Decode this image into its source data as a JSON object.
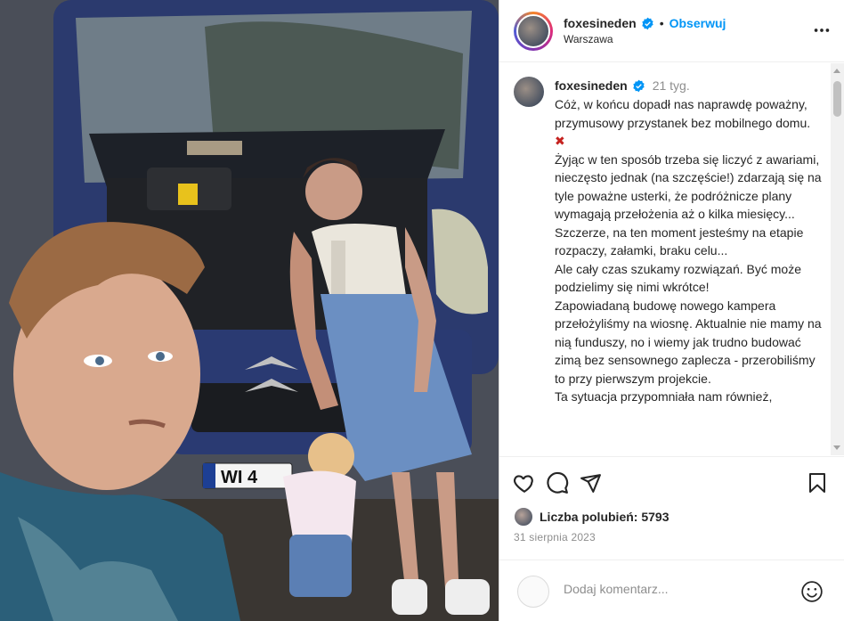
{
  "post": {
    "username": "foxesineden",
    "follow_label": "Obserwuj",
    "separator": "•",
    "location": "Warszawa",
    "caption_time": "21 tyg.",
    "caption_text": "Cóż, w końcu dopadł nas naprawdę poważny, przymusowy przystanek bez mobilnego domu.",
    "caption_mark": "✖",
    "caption_text_2": "Żyjąc w ten sposób trzeba się liczyć z awariami, nieczęsto jednak (na szczęście!) zdarzają się na tyle poważne usterki, że podróżnicze plany wymagają przełożenia aż o kilka miesięcy...\nSzczerze, na ten moment jesteśmy na etapie rozpaczy, załamki, braku celu...\nAle cały czas szukamy rozwiązań. Być może podzielimy się nimi wkrótce!\nZapowiadaną budowę nowego kampera przełożyliśmy na wiosnę. Aktualnie nie mamy na nią funduszy, no i wiemy jak trudno budować zimą bez sensownego zaplecza - przerobiliśmy to przy pierwszym projekcie.\nTa sytuacja przypomniała nam również,",
    "likes_label": "Liczba polubień: 5793",
    "date": "31 sierpnia 2023",
    "comment_placeholder": "Dodaj komentarz...",
    "plate_text": "WI 4"
  },
  "colors": {
    "follow_blue": "#0095f6",
    "verified_blue": "#0095f6",
    "x_red": "#c5221f"
  },
  "icons": {
    "more": "more-horizontal-icon",
    "like": "heart-icon",
    "comment": "comment-icon",
    "share": "share-icon",
    "save": "bookmark-icon",
    "emoji": "emoji-icon"
  }
}
